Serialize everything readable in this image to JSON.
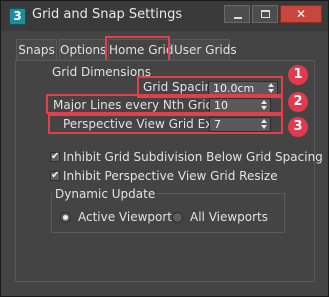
{
  "window": {
    "title": "Grid and Snap Settings",
    "app_icon_text": "3",
    "close_glyph": "✕"
  },
  "tabs": [
    {
      "label": "Snaps",
      "active": false
    },
    {
      "label": "Options",
      "active": false
    },
    {
      "label": "Home Grid",
      "active": true
    },
    {
      "label": "User Grids",
      "active": false
    }
  ],
  "grid_dimensions": {
    "group_label": "Grid Dimensions",
    "grid_spacing": {
      "label": "Grid Spacing:",
      "value": "10.0cm"
    },
    "major_lines": {
      "label": "Major Lines every Nth Grid Line:",
      "value": "10"
    },
    "perspective_extent": {
      "label": "Perspective View Grid Extent:",
      "value": "7"
    }
  },
  "options": {
    "inhibit_subdivision": {
      "label": "Inhibit Grid Subdivision Below Grid Spacing",
      "checked": true
    },
    "inhibit_perspective_resize": {
      "label": "Inhibit Perspective View Grid Resize",
      "checked": true
    }
  },
  "dynamic_update": {
    "group_label": "Dynamic Update",
    "active_viewport": {
      "label": "Active Viewport",
      "selected": true
    },
    "all_viewports": {
      "label": "All Viewports",
      "selected": false
    }
  },
  "annotations": {
    "badge1": "1",
    "badge2": "2",
    "badge3": "3",
    "color": "#e23a4c"
  },
  "check_glyph": "✔"
}
